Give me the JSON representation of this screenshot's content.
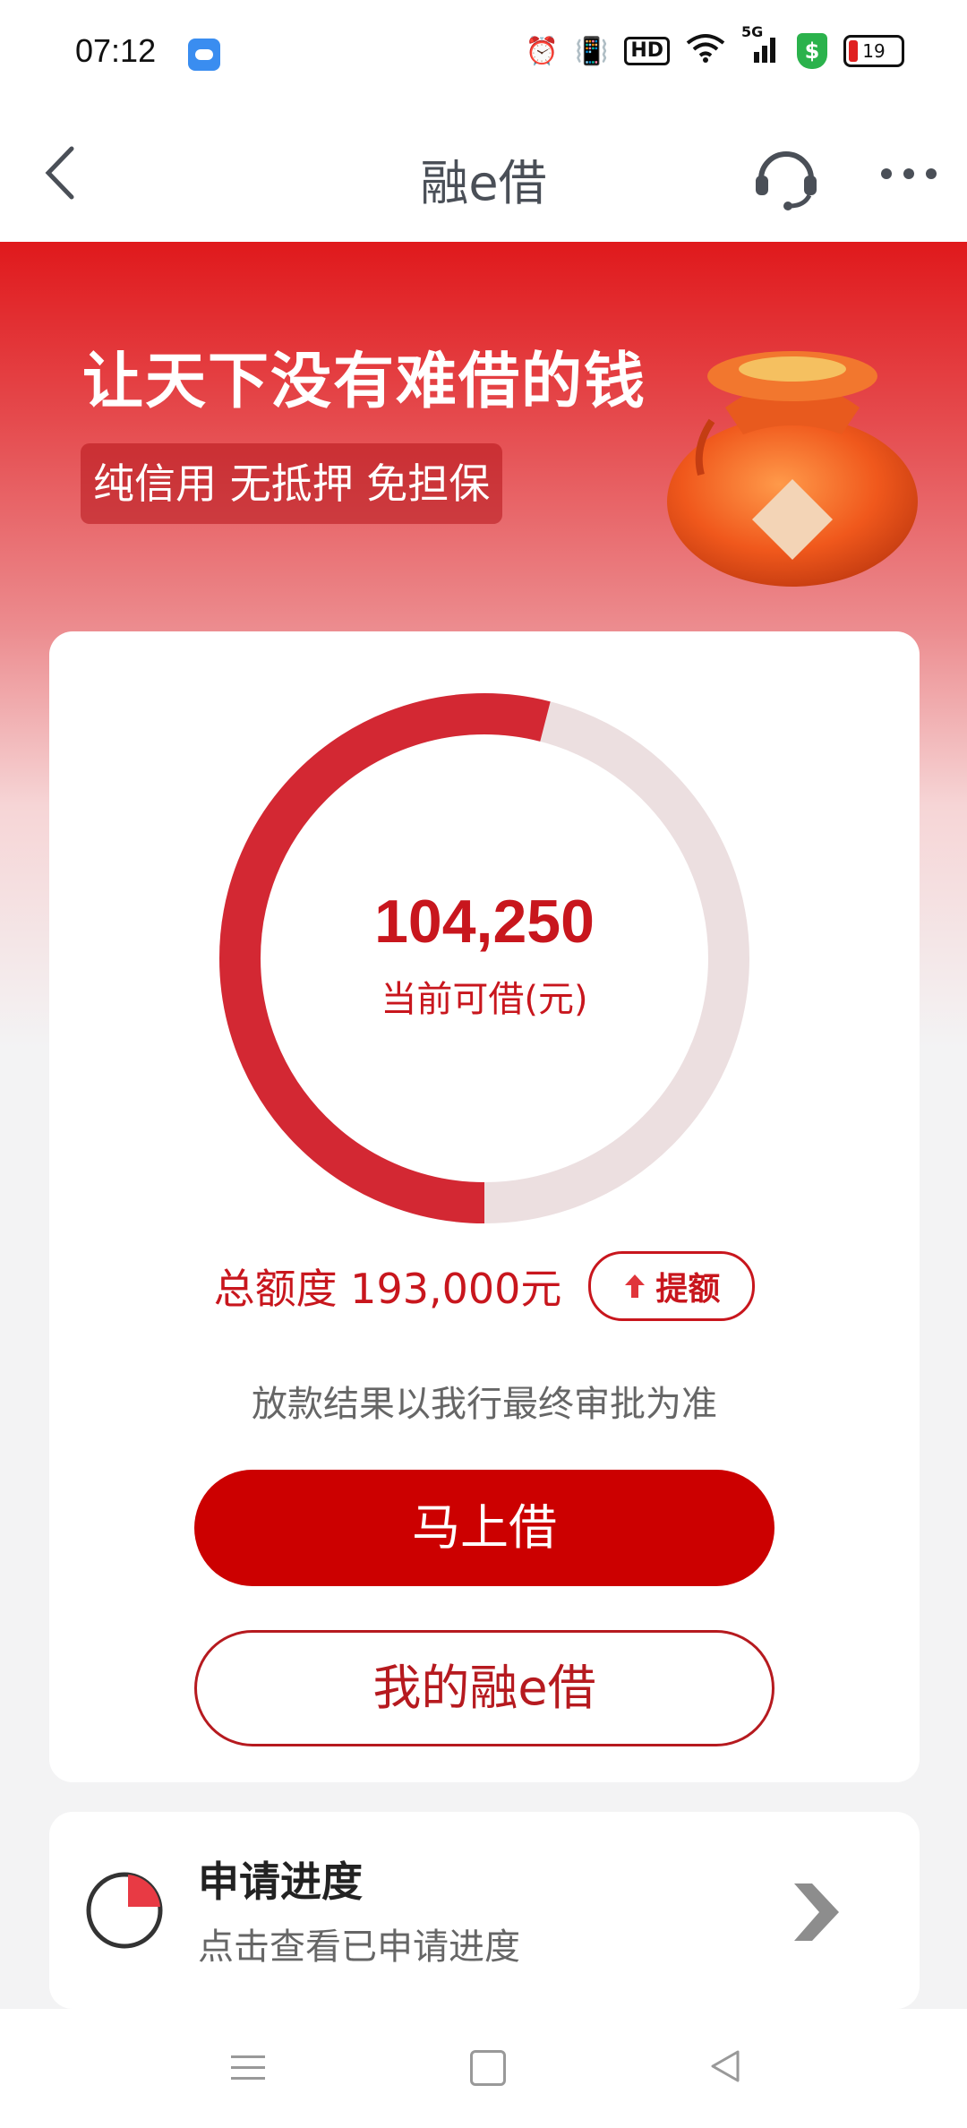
{
  "status_bar": {
    "time": "07:12",
    "hd_label": "HD",
    "network_label": "5G",
    "security_badge": "$",
    "battery_level": "19"
  },
  "header": {
    "title": "融e借",
    "icons": [
      "back-icon",
      "headset-icon",
      "more-icon"
    ]
  },
  "banner": {
    "slogan": "让天下没有难借的钱",
    "tags": "纯信用 无抵押 免担保"
  },
  "credit": {
    "available_amount": "104,250",
    "available_label": "当前可借(元)",
    "total_label": "总额度 193,000元",
    "raise_label": "提额",
    "available_fraction": 0.54,
    "notice": "放款结果以我行最终审批为准"
  },
  "actions": {
    "borrow_label": "马上借",
    "my_loan_label": "我的融e借"
  },
  "progress": {
    "title": "申请进度",
    "subtitle": "点击查看已申请进度"
  },
  "colors": {
    "brand_red": "#cc0000",
    "ring_used": "#d32833",
    "ring_track": "#ecdfe0"
  }
}
